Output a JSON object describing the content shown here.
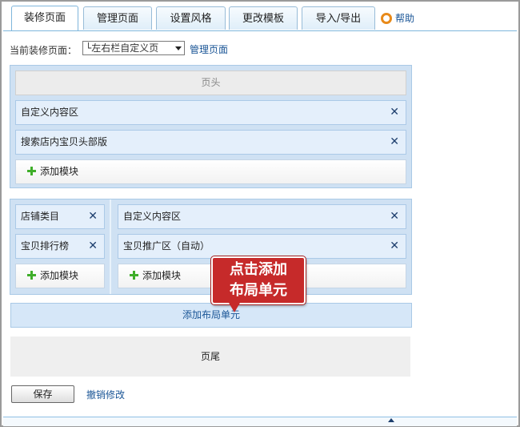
{
  "tabs": [
    {
      "label": "装修页面",
      "active": true
    },
    {
      "label": "管理页面",
      "active": false
    },
    {
      "label": "设置风格",
      "active": false
    },
    {
      "label": "更改模板",
      "active": false
    },
    {
      "label": "导入/导出",
      "active": false
    }
  ],
  "help_label": "帮助",
  "toolbar": {
    "current_page_label": "当前装修页面：",
    "selected_page": "└左右栏自定义页",
    "manage_link": "管理页面"
  },
  "top_region": {
    "header_label": "页头",
    "rows": [
      "自定义内容区",
      "搜索店内宝贝头部版"
    ],
    "add_module": "添加模块"
  },
  "layout_region": {
    "left_rows": [
      "店铺类目",
      "宝贝排行榜"
    ],
    "left_add_module": "添加模块",
    "right_rows": [
      "自定义内容区",
      "宝贝推广区（自动）"
    ],
    "right_add_module": "添加模块"
  },
  "add_layout_label": "添加布局单元",
  "footer_label": "页尾",
  "save_button": "保存",
  "undo_link": "撤销修改",
  "callout": {
    "line1": "点击添加",
    "line2": "布局单元"
  },
  "close_glyph": "✕"
}
